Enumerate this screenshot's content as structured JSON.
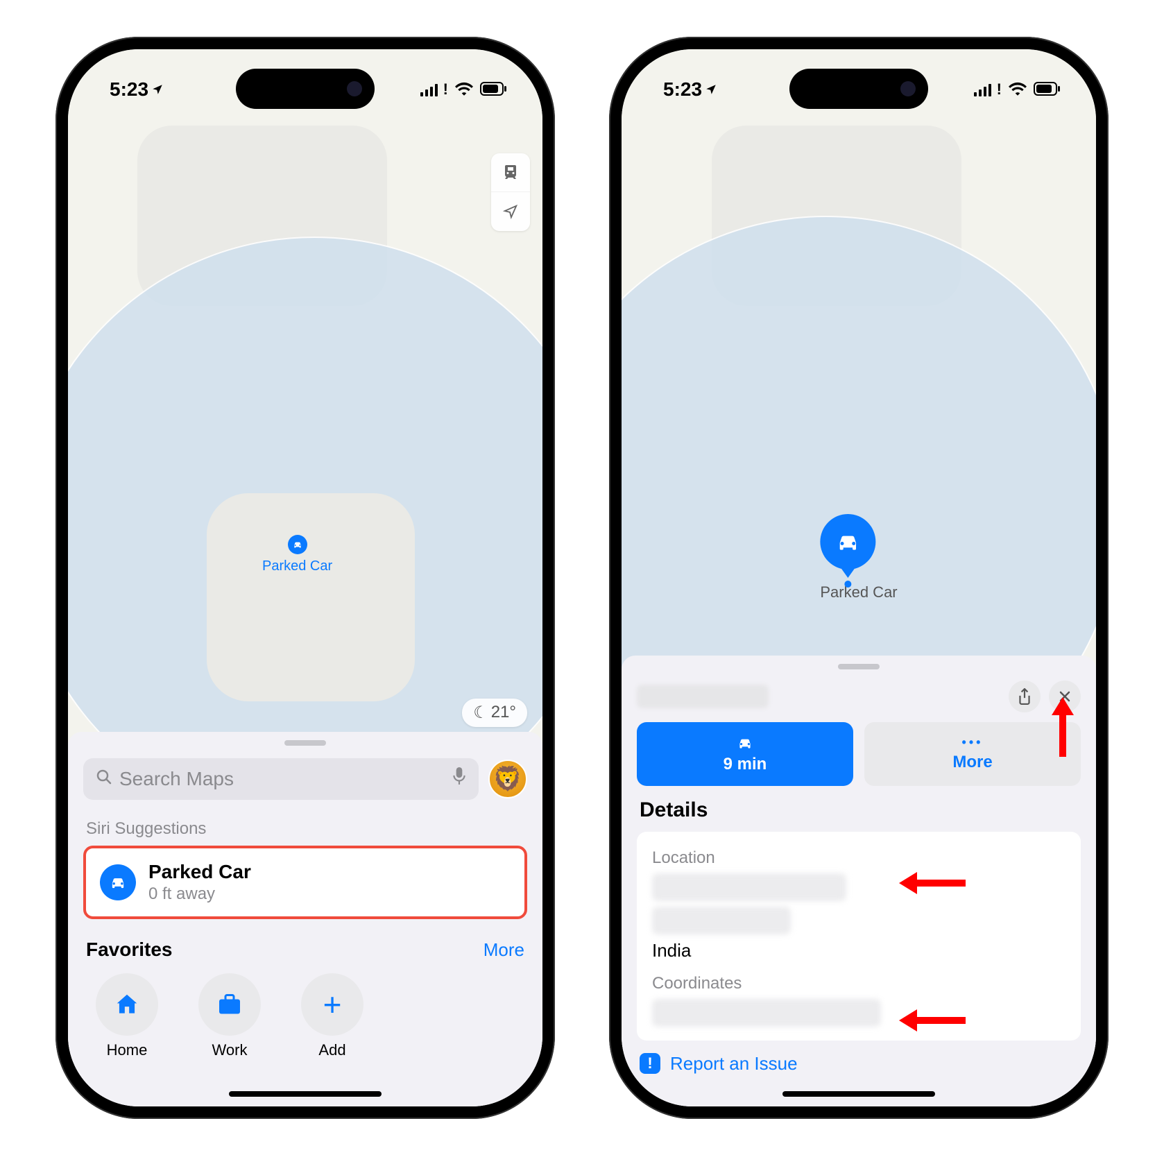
{
  "status": {
    "time": "5:23",
    "weather": "21°"
  },
  "icons": {
    "car": "car-icon",
    "location_arrow": "location-arrow-icon",
    "search": "search-icon",
    "mic": "mic-icon",
    "home": "home-icon",
    "briefcase": "briefcase-icon",
    "plus": "plus-icon",
    "share": "share-icon",
    "close": "close-icon",
    "transit": "transit-icon",
    "moon": "moon-icon"
  },
  "map": {
    "pin_label_small": "Parked Car",
    "pin_label_large": "Parked Car"
  },
  "sheet1": {
    "search_placeholder": "Search Maps",
    "siri_header": "Siri Suggestions",
    "siri_item": {
      "title": "Parked Car",
      "subtitle": "0 ft away"
    },
    "favorites_header": "Favorites",
    "favorites_more": "More",
    "favorites": [
      {
        "label": "Home"
      },
      {
        "label": "Work"
      },
      {
        "label": "Add"
      }
    ]
  },
  "sheet2": {
    "directions_time": "9 min",
    "more_label": "More",
    "details_header": "Details",
    "location_label": "Location",
    "location_country": "India",
    "coordinates_label": "Coordinates",
    "report_label": "Report an Issue"
  }
}
